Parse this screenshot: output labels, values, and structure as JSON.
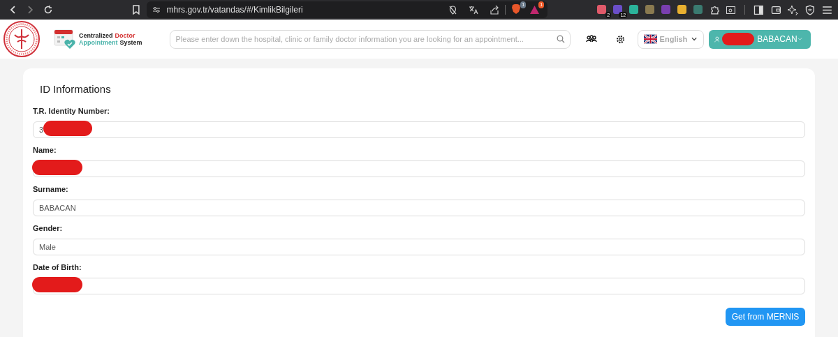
{
  "browser": {
    "url": "mhrs.gov.tr/vatandas/#/KimlikBilgileri",
    "brave_badge": "1",
    "rewards_badge": "1",
    "extensions": [
      {
        "badge": "2",
        "color": "#e05a6a"
      },
      {
        "badge": "12",
        "color": "#6b4fc8"
      },
      {
        "color": "#2bb39a"
      },
      {
        "color": "#8a7a50"
      },
      {
        "color": "#7a3fb0"
      },
      {
        "color": "#e8b030"
      },
      {
        "color": "#3a7a70"
      }
    ]
  },
  "header": {
    "app_name_line1": "Centralized",
    "app_name_highlight": "Doctor",
    "app_name_line2a": "Appointment",
    "app_name_line2b": "System",
    "search": {
      "placeholder": "Please enter down the hospital, clinic or family doctor information you are looking for an appointment..."
    },
    "language": "English",
    "user": {
      "name": "BABACAN",
      "redacted": true
    }
  },
  "card": {
    "title": "ID Informations",
    "fields": [
      {
        "label": "T.R. Identity Number:",
        "value": "3",
        "redacted": true
      },
      {
        "label": "Name:",
        "redacted": true
      },
      {
        "label": "Surname:",
        "value": "BABACAN",
        "redacted": false
      },
      {
        "label": "Gender:",
        "value": "Male",
        "redacted": false
      },
      {
        "label": "Date of Birth:",
        "redacted": true
      }
    ],
    "button": "Get from MERNIS"
  }
}
